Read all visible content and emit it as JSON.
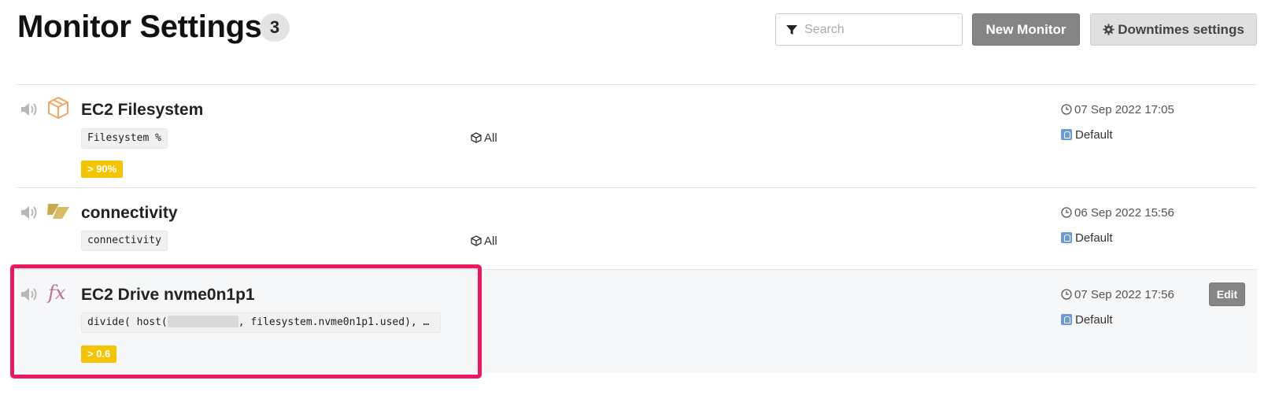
{
  "header": {
    "title": "Monitor Settings",
    "count": "3",
    "search_placeholder": "Search",
    "new_monitor_label": "New Monitor",
    "downtimes_label": "Downtimes settings"
  },
  "monitors": [
    {
      "name": "EC2 Filesystem",
      "type_icon": "cube-outline-icon",
      "metric": "Filesystem %",
      "threshold": "> 90%",
      "scope": "All",
      "date": "07 Sep 2022 17:05",
      "notification": "Default"
    },
    {
      "name": "connectivity",
      "type_icon": "connectivity-icon",
      "metric": "connectivity",
      "scope": "All",
      "date": "06 Sep 2022 15:56",
      "notification": "Default"
    },
    {
      "name": "EC2 Drive nvme0n1p1",
      "type_icon": "fx-icon",
      "metric_prefix": "divide( host(",
      "metric_suffix": ", filesystem.nvme0n1p1.used), …",
      "threshold": "> 0.6",
      "date": "07 Sep 2022 17:56",
      "notification": "Default",
      "edit_label": "Edit"
    }
  ],
  "colors": {
    "threshold_bg": "#f5c400",
    "highlight": "#f1175f",
    "button_gray": "#858585",
    "cube_orange": "#f0a560",
    "connectivity_gold": "#c9a94c",
    "fx_pink": "#c0708e"
  }
}
